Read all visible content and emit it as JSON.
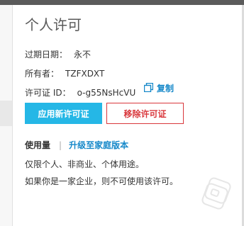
{
  "title": "个人许可",
  "fields": {
    "expiry_label": "过期日期：",
    "expiry_value": "永不",
    "owner_label": "所有者：",
    "owner_value": "TZFXDXT",
    "license_label": "许可证 ID：",
    "license_value": "o-g55NsHcVU"
  },
  "copy_label": "复制",
  "buttons": {
    "apply": "应用新许可证",
    "remove": "移除许可证"
  },
  "usage": {
    "label": "使用量",
    "separator": "|",
    "upgrade": "升级至家庭版本"
  },
  "description": {
    "line1": "仅限个人、非商业、个体用途。",
    "line2": "如果你是一家企业，则不可使用该许可。"
  },
  "colors": {
    "accent": "#1588c9",
    "apply_button": "#25b7e6",
    "remove_button": "#d9373c"
  }
}
